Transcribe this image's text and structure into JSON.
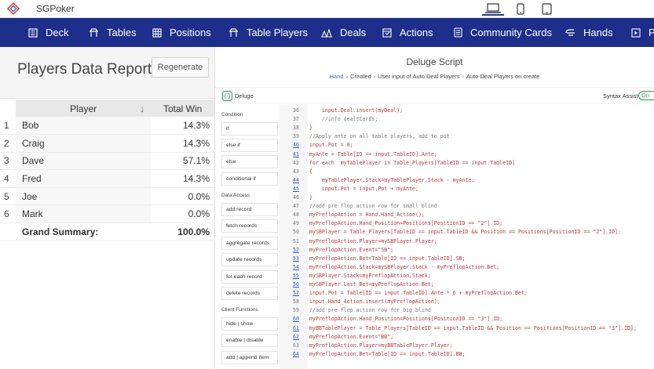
{
  "app": {
    "name": "SGPoker",
    "colors": {
      "nav_bg": "#1d2f8a",
      "link": "#2b5ac7",
      "accent_green": "#2a9a4a"
    }
  },
  "nav": {
    "items": [
      {
        "label": "Deck",
        "icon": "deck-icon"
      },
      {
        "label": "Tables",
        "icon": "table-icon"
      },
      {
        "label": "Positions",
        "icon": "grid-icon"
      },
      {
        "label": "Table Players",
        "icon": "table-icon"
      },
      {
        "label": "Deals",
        "icon": "deals-icon"
      },
      {
        "label": "Actions",
        "icon": "actions-icon"
      },
      {
        "label": "Community Cards",
        "icon": "cards-icon"
      },
      {
        "label": "Hands",
        "icon": "hands-icon"
      },
      {
        "label": "P",
        "icon": "play-icon"
      }
    ]
  },
  "report": {
    "title": "Players Data Report",
    "regenerate_label": "Regenerate",
    "columns": [
      "Player",
      "Total Win"
    ],
    "rows": [
      {
        "num": "1",
        "player": "Bob",
        "win": "14.3%"
      },
      {
        "num": "2",
        "player": "Craig",
        "win": "14.3%"
      },
      {
        "num": "3",
        "player": "Dave",
        "win": "57.1%"
      },
      {
        "num": "4",
        "player": "Fred",
        "win": "14.3%"
      },
      {
        "num": "5",
        "player": "Joe",
        "win": "0.0%"
      },
      {
        "num": "6",
        "player": "Mark",
        "win": "0.0%"
      }
    ],
    "summary": {
      "label": "Grand Summary:",
      "value": "100.0%"
    }
  },
  "script": {
    "title": "Deluge Script",
    "breadcrumb": [
      "Hand",
      "Created",
      "User input of Auto Deal Players",
      "Auto Deal Players on create"
    ],
    "editor_label": "Deluge",
    "syntax_assist_label": "Syntax Assist",
    "toggle_label": "On"
  },
  "palette": {
    "sections": [
      {
        "title": "Condition",
        "items": [
          "if",
          "else if",
          "else",
          "conditional if"
        ]
      },
      {
        "title": "Data Access",
        "items": [
          "add record",
          "fetch records",
          "aggregate records",
          "update records",
          "for each record",
          "delete records"
        ]
      },
      {
        "title": "Client Functions",
        "items": [
          "hide | show",
          "enable | disable",
          "add | append item"
        ]
      }
    ]
  },
  "code_lines": [
    {
      "n": "36",
      "t": "    input.Deal.insert(myDeal);",
      "c": "red",
      "link": false
    },
    {
      "n": "37",
      "t": "    //info dealtCards;",
      "c": "comment",
      "link": false
    },
    {
      "n": "38",
      "t": "}",
      "c": "red",
      "link": false
    },
    {
      "n": "39",
      "t": "//Apply ante on all table players, add to pot",
      "c": "comment",
      "link": false
    },
    {
      "n": "40",
      "t": "input.Pot = 0;",
      "c": "red",
      "link": true
    },
    {
      "n": "41",
      "t": "myAnte = Table[ID == input.TableID].Ante;",
      "c": "red",
      "link": true
    },
    {
      "n": "42",
      "t": "for each  myTablePlayer in Table_Players[TableID == input.TableID]",
      "c": "red",
      "link": false
    },
    {
      "n": "43",
      "t": "{",
      "c": "red",
      "link": false
    },
    {
      "n": "44",
      "t": "    myTablePlayer.Stack=myTablePlayer.Stack - myAnte;",
      "c": "red",
      "link": true
    },
    {
      "n": "45",
      "t": "    input.Pot = input.Pot + myAnte;",
      "c": "red",
      "link": true
    },
    {
      "n": "46",
      "t": "}",
      "c": "red",
      "link": false
    },
    {
      "n": "47",
      "t": "//add pre flop action row for small blind",
      "c": "comment",
      "link": false
    },
    {
      "n": "48",
      "t": "myPreflopAction = Hand.Hand_Action();",
      "c": "red",
      "link": false
    },
    {
      "n": "49",
      "t": "myPreflopAction.Hand_Position=Positions[PositionID == \"2\"].ID;",
      "c": "red",
      "link": false
    },
    {
      "n": "50",
      "t": "mySBPlayer = Table_Players[TableID == input.TableID && Position == Positions[PositionID == \"2\"].ID];",
      "c": "red",
      "link": false
    },
    {
      "n": "51",
      "t": "myPreflopAction.Player=mySBPlayer.Player;",
      "c": "red",
      "link": false
    },
    {
      "n": "52",
      "t": "myPreflopAction.Event=\"SB\";",
      "c": "red",
      "link": true
    },
    {
      "n": "53",
      "t": "myPreflopAction.Bet=Table[ID == input.TableID].SB;",
      "c": "red",
      "link": true
    },
    {
      "n": "54",
      "t": "myPreflopAction.Stack=mySBPlayer.Stack - myPreflopAction.Bet;",
      "c": "red",
      "link": true
    },
    {
      "n": "55",
      "t": "mySBPlayer.Stack=myPreflopAction.Stack;",
      "c": "red",
      "link": true
    },
    {
      "n": "56",
      "t": "mySBPlayer.Last_Bet=myPreflopAction.Bet;",
      "c": "red",
      "link": true
    },
    {
      "n": "57",
      "t": "input.Pot = Table[ID == input.TableID].Ante * 6 + myPreflopAction.Bet;",
      "c": "red",
      "link": true
    },
    {
      "n": "58",
      "t": "input.Hand_Action.insert(myPreflopAction);",
      "c": "red",
      "link": false
    },
    {
      "n": "59",
      "t": "//add pre flop action row for big blind",
      "c": "comment",
      "link": false
    },
    {
      "n": "60",
      "t": "myPreflopAction.Hand_Position=Positions[PositionID == \"3\"].ID;",
      "c": "red",
      "link": true
    },
    {
      "n": "61",
      "t": "myBBTablePlayer = Table_Players[TableID == input.TableID && Position == Positions[PositionID == \"3\"].ID];",
      "c": "red",
      "link": true
    },
    {
      "n": "62",
      "t": "myPreflopAction.Event=\"BB\";",
      "c": "red",
      "link": true
    },
    {
      "n": "63",
      "t": "myPreflopAction.Player=myBBTablePlayer.Player;",
      "c": "red",
      "link": false
    },
    {
      "n": "64",
      "t": "myPreflopAction.Bet=Table[ID == input.TableID].BB;",
      "c": "red",
      "link": true
    }
  ]
}
